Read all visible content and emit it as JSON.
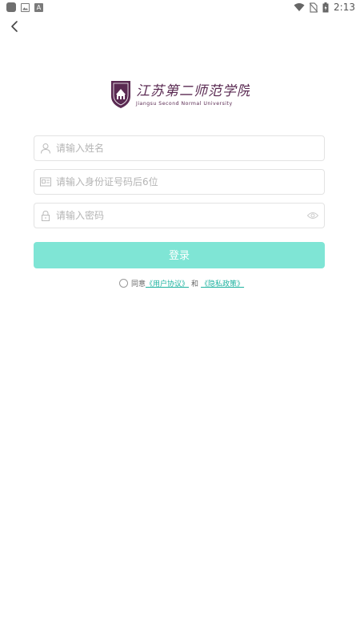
{
  "status_bar": {
    "time": "2:13"
  },
  "logo": {
    "name_cn": "江苏第二师范学院",
    "name_en": "Jiangsu Second Normal University"
  },
  "form": {
    "name_placeholder": "请输入姓名",
    "id_placeholder": "请输入身份证号码后6位",
    "password_placeholder": "请输入密码"
  },
  "login_button": "登录",
  "agreement": {
    "prefix": "同意",
    "user_agreement": "《用户协议》",
    "and": "和",
    "privacy_policy": "《隐私政策》"
  },
  "colors": {
    "accent": "#7fe5d5",
    "link": "#1fb3a0",
    "brand": "#5a2a52"
  }
}
